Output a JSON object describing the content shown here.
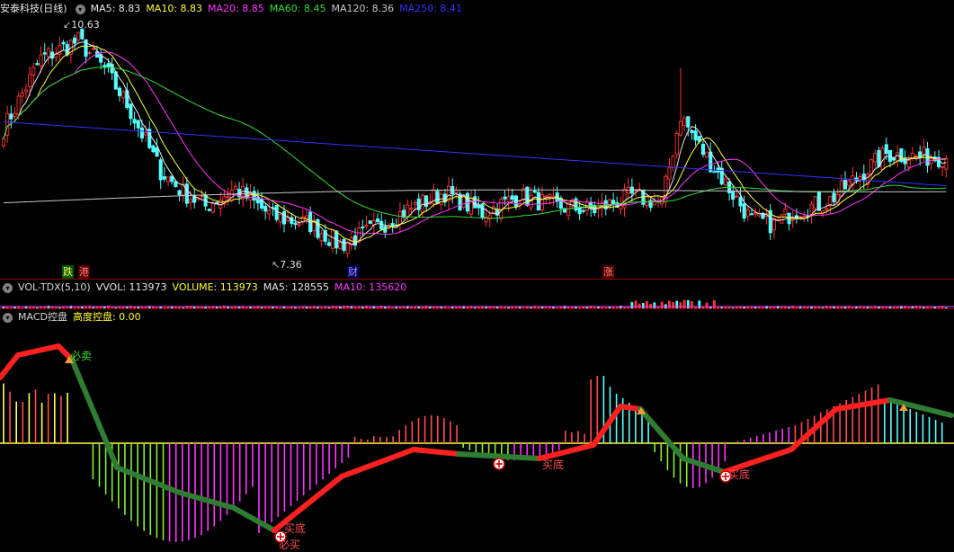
{
  "price_header": {
    "title": "安泰科技(日线)",
    "items": [
      {
        "label": "MA5:",
        "value": "8.83",
        "color": "#e8e8e8"
      },
      {
        "label": "MA10:",
        "value": "8.83",
        "color": "#ffff33"
      },
      {
        "label": "MA20:",
        "value": "8.85",
        "color": "#ff33ff"
      },
      {
        "label": "MA60:",
        "value": "8.45",
        "color": "#33dd33"
      },
      {
        "label": "MA120:",
        "value": "8.36",
        "color": "#c8c8c8"
      },
      {
        "label": "MA250:",
        "value": "8.41",
        "color": "#3333ff"
      }
    ]
  },
  "volume_header": {
    "title": "VOL-TDX(5,10)",
    "items": [
      {
        "label": "VVOL:",
        "value": "113973",
        "color": "#e8e8e8"
      },
      {
        "label": "VOLUME:",
        "value": "113973",
        "color": "#ffff33"
      },
      {
        "label": "MA5:",
        "value": "128555",
        "color": "#e8e8e8"
      },
      {
        "label": "MA10:",
        "value": "135620",
        "color": "#ff33ff"
      }
    ]
  },
  "macd_header": {
    "title": "MACD控盘",
    "items": [
      {
        "label": "高度控盘:",
        "value": "0.00",
        "color": "#ffff33"
      }
    ]
  },
  "price_labels": {
    "high": "10.63",
    "low": "7.36"
  },
  "event_markers": [
    {
      "text": "跌",
      "bg": "#005500",
      "fg": "#ffff66"
    },
    {
      "text": "港",
      "bg": "#550000",
      "fg": "#ff8080"
    },
    {
      "text": "财",
      "bg": "#000055",
      "fg": "#9999ff"
    },
    {
      "text": "涨",
      "bg": "#550000",
      "fg": "#ff8080"
    }
  ],
  "signals": {
    "sell_1": "必卖",
    "bottom_1": "买底",
    "buy_1": "必买",
    "bottom_2": "买底",
    "bottom_3": "买底"
  },
  "chart_data": {
    "type": "candlestick",
    "instrument": "安泰科技",
    "period": "日线",
    "ylim": [
      7.2,
      10.8
    ],
    "moving_averages": [
      {
        "name": "MA5",
        "last": 8.83,
        "color": "#e8e8e8"
      },
      {
        "name": "MA10",
        "last": 8.83,
        "color": "#ffff33"
      },
      {
        "name": "MA20",
        "last": 8.85,
        "color": "#ff33ff"
      },
      {
        "name": "MA60",
        "last": 8.45,
        "color": "#33dd33"
      },
      {
        "name": "MA120",
        "last": 8.36,
        "color": "#c8c8c8"
      },
      {
        "name": "MA250",
        "last": 8.41,
        "color": "#3333ff"
      }
    ],
    "price_anchors": [
      [
        0,
        9.2
      ],
      [
        10,
        10.2
      ],
      [
        20,
        10.45
      ],
      [
        27,
        10.05
      ],
      [
        33,
        9.55
      ],
      [
        42,
        8.6
      ],
      [
        48,
        8.3
      ],
      [
        54,
        8.1
      ],
      [
        62,
        8.35
      ],
      [
        72,
        7.95
      ],
      [
        82,
        7.85
      ],
      [
        90,
        7.55
      ],
      [
        98,
        7.75
      ],
      [
        108,
        8.05
      ],
      [
        118,
        8.3
      ],
      [
        128,
        8.0
      ],
      [
        138,
        8.25
      ],
      [
        148,
        8.1
      ],
      [
        158,
        8.05
      ],
      [
        168,
        8.25
      ],
      [
        176,
        8.15
      ],
      [
        181,
        9.4
      ],
      [
        186,
        8.95
      ],
      [
        192,
        8.5
      ],
      [
        200,
        7.9
      ],
      [
        206,
        7.85
      ],
      [
        212,
        8.05
      ],
      [
        220,
        8.15
      ],
      [
        228,
        8.5
      ],
      [
        236,
        8.85
      ],
      [
        245,
        8.8
      ],
      [
        252,
        8.8
      ]
    ],
    "volume": {
      "vvol": 113973,
      "ma5": 128555,
      "ma10": 135620
    },
    "macd": {
      "control": 0.0
    }
  }
}
